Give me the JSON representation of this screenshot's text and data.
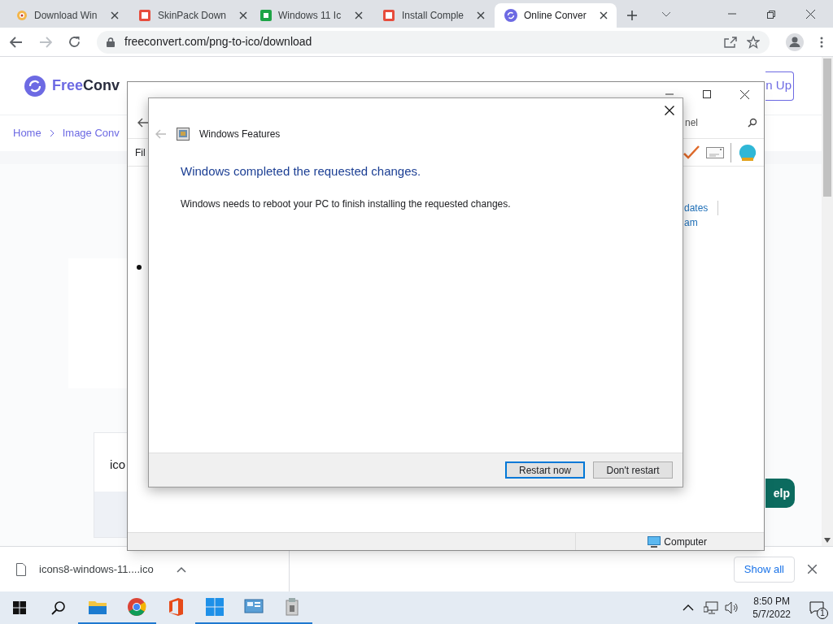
{
  "tabs": [
    {
      "title": "Download Win",
      "kind": "generic",
      "selected": false
    },
    {
      "title": "SkinPack Down",
      "kind": "sp",
      "selected": false
    },
    {
      "title": "Windows 11 Ic",
      "kind": "green",
      "selected": false
    },
    {
      "title": "Install Comple",
      "kind": "sp",
      "selected": false
    },
    {
      "title": "Online Conver",
      "kind": "convert",
      "selected": true
    }
  ],
  "address": "freeconvert.com/png-to-ico/download",
  "page": {
    "logo_a": "Free",
    "logo_b": "Conv",
    "signup": "n Up",
    "breadcrumb": [
      "Home",
      "Image Conv"
    ],
    "card_text": "ico",
    "help": "elp"
  },
  "control_panel": {
    "search": "nel",
    "menu": "Fil",
    "links": [
      "dates",
      "am"
    ],
    "status": "Computer"
  },
  "dialog": {
    "title": "Windows Features",
    "heading": "Windows completed the requested changes.",
    "message": "Windows needs to reboot your PC to finish installing the requested changes.",
    "buttons": [
      {
        "label": "Restart now",
        "selected": true
      },
      {
        "label": "Don't restart",
        "selected": false
      }
    ]
  },
  "download": {
    "file": "icons8-windows-11....ico",
    "show_all": "Show all"
  },
  "taskbar": {
    "apps": [
      {
        "kind": "folder",
        "running": true
      },
      {
        "kind": "chrome",
        "running": true
      },
      {
        "kind": "office",
        "running": false
      },
      {
        "kind": "win11",
        "running": true
      },
      {
        "kind": "panel",
        "running": true
      },
      {
        "kind": "installer",
        "running": true
      }
    ],
    "time": "8:50 PM",
    "date": "5/7/2022",
    "notifications": "1"
  }
}
